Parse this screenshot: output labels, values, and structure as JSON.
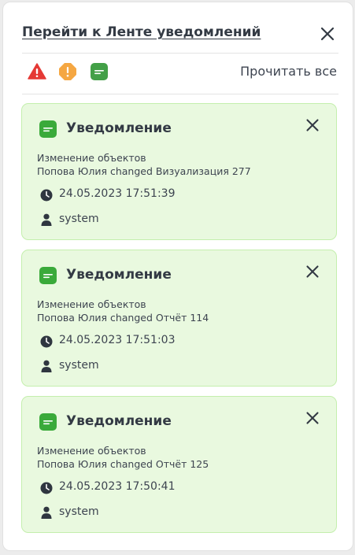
{
  "header": {
    "link_label": "Перейти к Ленте уведомлений",
    "read_all_label": "Прочитать все"
  },
  "filters": [
    {
      "icon": "error-triangle-icon",
      "color": "#e53935"
    },
    {
      "icon": "warning-octagon-icon",
      "color": "#f5a742"
    },
    {
      "icon": "notification-message-icon",
      "color": "#43a047"
    }
  ],
  "colors": {
    "card_background": "#e9f9df",
    "card_border": "#c4efad",
    "notification_icon": "#3aaa3a"
  },
  "notifications": [
    {
      "title": "Уведомление",
      "category": "Изменение объектов",
      "message": "Попова Юлия changed Визуализация 277",
      "timestamp": "24.05.2023 17:51:39",
      "user": "system"
    },
    {
      "title": "Уведомление",
      "category": "Изменение объектов",
      "message": "Попова Юлия changed Отчёт 114",
      "timestamp": "24.05.2023 17:51:03",
      "user": "system"
    },
    {
      "title": "Уведомление",
      "category": "Изменение объектов",
      "message": "Попова Юлия changed Отчёт 125",
      "timestamp": "24.05.2023 17:50:41",
      "user": "system"
    }
  ]
}
